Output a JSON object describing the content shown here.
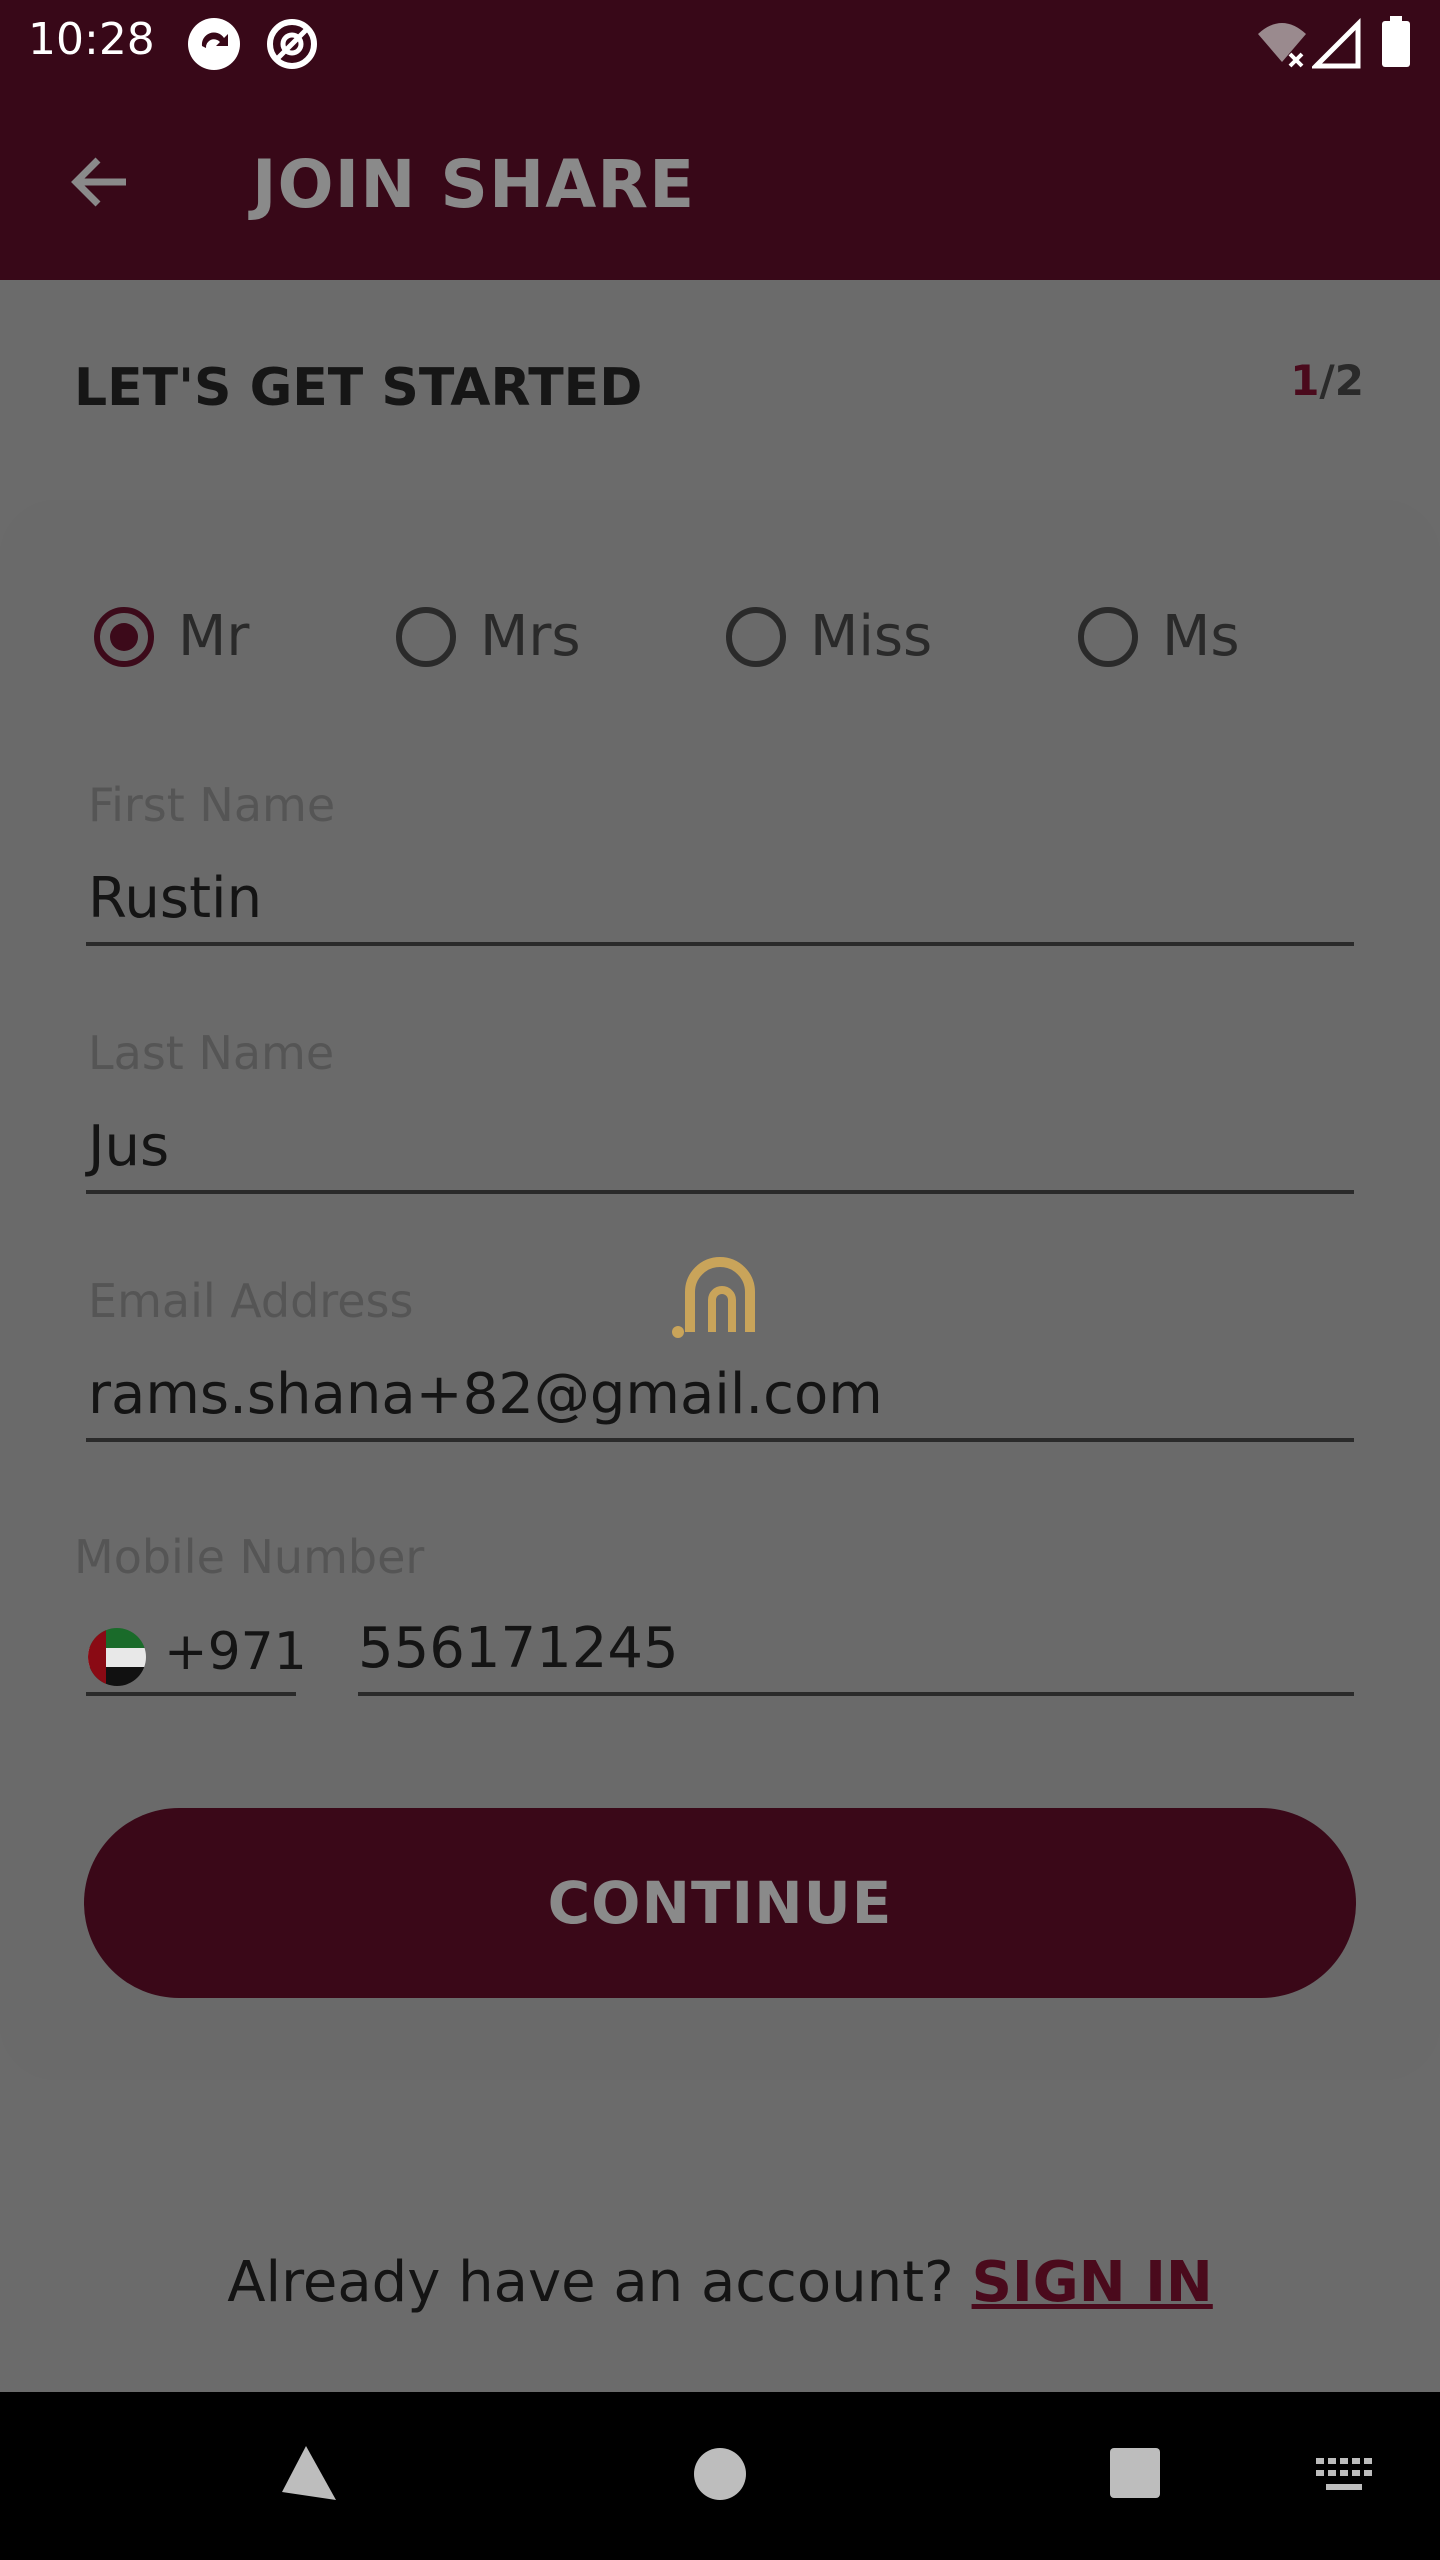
{
  "status_bar": {
    "time": "10:28",
    "icons": [
      "sync-icon",
      "at-icon",
      "wifi-off-icon",
      "signal-icon",
      "battery-icon"
    ]
  },
  "appbar": {
    "title": "JOIN SHARE",
    "back_icon": "arrow-left-icon"
  },
  "header": {
    "title": "LET'S GET STARTED",
    "step_current": "1",
    "step_total": "/2"
  },
  "form": {
    "salutations": [
      {
        "label": "Mr",
        "selected": true
      },
      {
        "label": "Mrs",
        "selected": false
      },
      {
        "label": "Miss",
        "selected": false
      },
      {
        "label": "Ms",
        "selected": false
      }
    ],
    "first_name": {
      "label": "First Name",
      "value": "Rustin"
    },
    "last_name": {
      "label": "Last Name",
      "value": "Jus"
    },
    "email": {
      "label": "Email Address",
      "value": "rams.shana+82@gmail.com"
    },
    "mobile": {
      "label": "Mobile Number",
      "country_code": "+971",
      "number": "556171245",
      "flag": "uae-flag-icon"
    }
  },
  "continue_button": {
    "label": "CONTINUE"
  },
  "footer": {
    "prompt": "Already have an account? ",
    "signin_label": "SIGN IN"
  },
  "colors": {
    "brand": "#380818",
    "overlay_bg": "#6b6b6b"
  },
  "nav_bar": {
    "icons": [
      "back-triangle-icon",
      "home-circle-icon",
      "recents-square-icon",
      "keyboard-icon"
    ]
  }
}
